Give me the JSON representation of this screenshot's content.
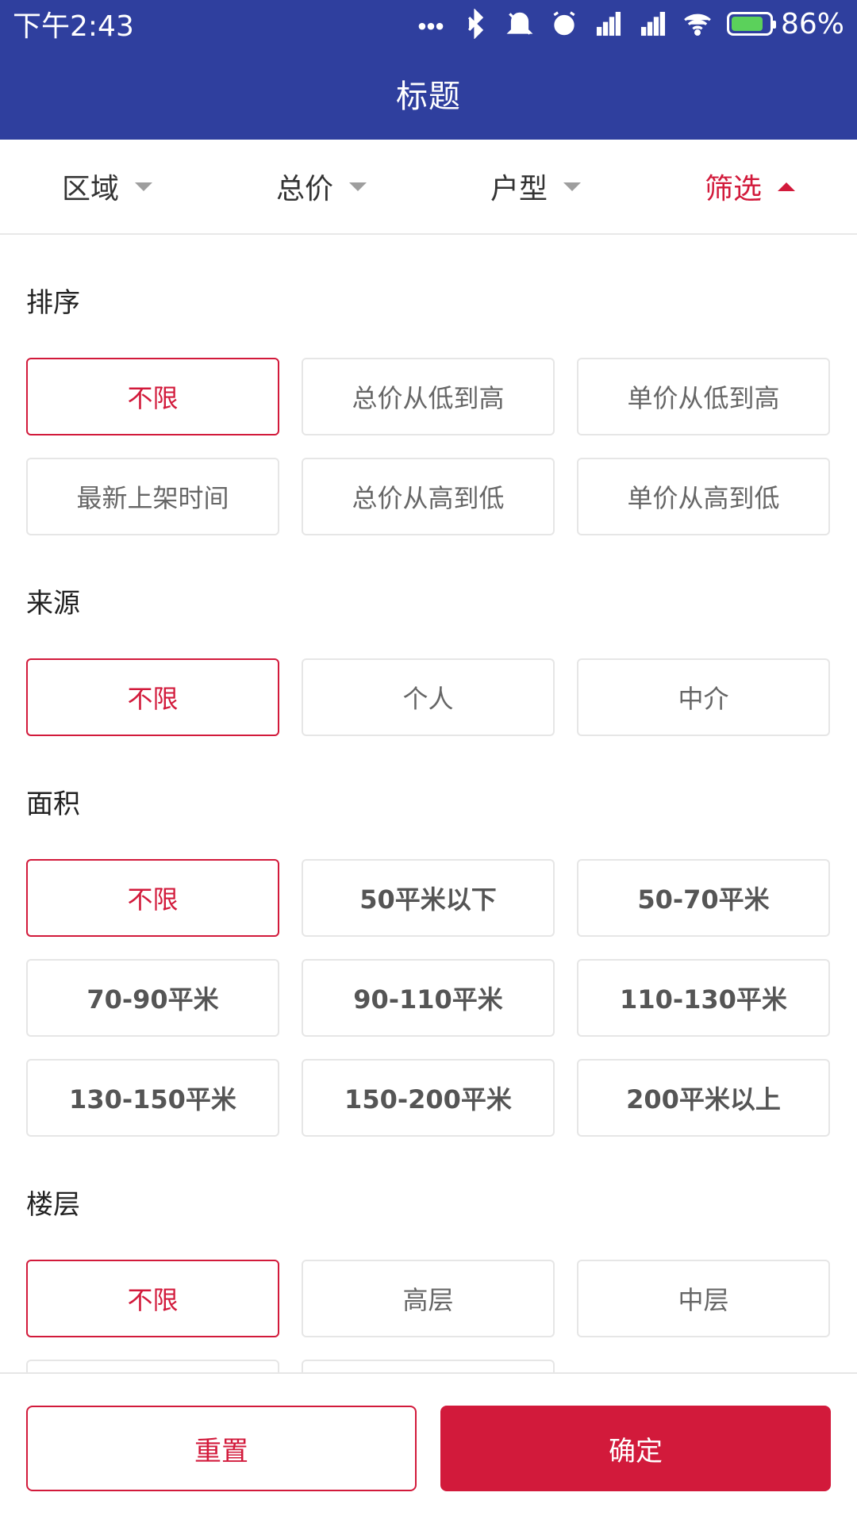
{
  "status_bar": {
    "time": "下午2:43",
    "battery_percent": "86%",
    "battery_level": 0.86,
    "icons": [
      "more-dots-icon",
      "bluetooth-icon",
      "vibrate-off-icon",
      "alarm-icon",
      "signal-icon",
      "signal-icon",
      "wifi-icon",
      "battery-charging-icon"
    ],
    "battery_fill_color": "#5bd15b"
  },
  "appbar": {
    "title": "标题",
    "bg_color": "#2f3f9e"
  },
  "filters": {
    "tabs": [
      {
        "label": "区域",
        "active": false
      },
      {
        "label": "总价",
        "active": false
      },
      {
        "label": "户型",
        "active": false
      },
      {
        "label": "筛选",
        "active": true
      }
    ],
    "active_color": "#d21a3b"
  },
  "sections": {
    "sort": {
      "title": "排序",
      "options": [
        "不限",
        "总价从低到高",
        "单价从低到高",
        "最新上架时间",
        "总价从高到低",
        "单价从高到低"
      ],
      "selected": "不限"
    },
    "source": {
      "title": "来源",
      "options": [
        "不限",
        "个人",
        "中介"
      ],
      "selected": "不限"
    },
    "area": {
      "title": "面积",
      "options": [
        "不限",
        "50平米以下",
        "50-70平米",
        "70-90平米",
        "90-110平米",
        "110-130平米",
        "130-150平米",
        "150-200平米",
        "200平米以上"
      ],
      "selected": "不限"
    },
    "floor": {
      "title": "楼层",
      "options": [
        "不限",
        "高层",
        "中层"
      ],
      "selected": "不限"
    }
  },
  "actions": {
    "reset_label": "重置",
    "confirm_label": "确定",
    "accent_color": "#d21a3b"
  }
}
